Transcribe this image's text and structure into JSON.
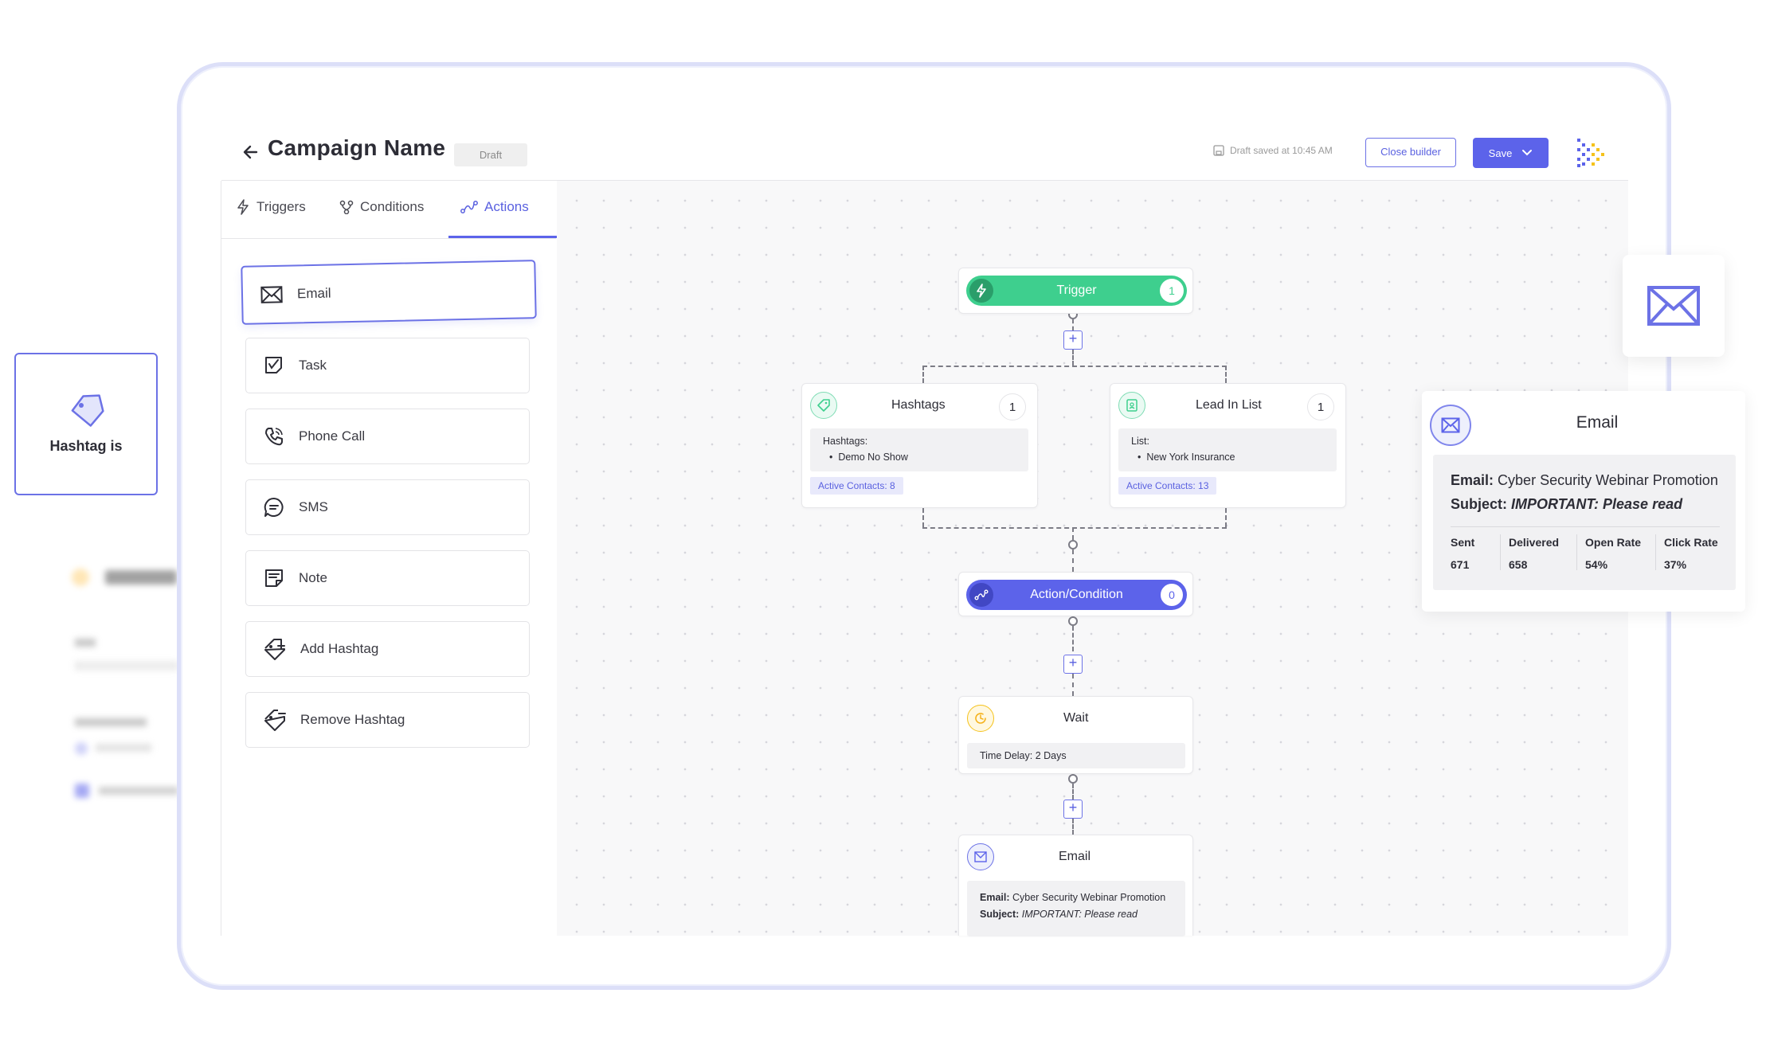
{
  "header": {
    "title": "Campaign Name",
    "status_badge": "Draft",
    "save_status": "Draft saved at 10:45 AM",
    "close_button": "Close builder",
    "save_button": "Save"
  },
  "sidebar": {
    "tabs": [
      {
        "label": "Triggers",
        "icon": "lightning-icon"
      },
      {
        "label": "Conditions",
        "icon": "branch-icon"
      },
      {
        "label": "Actions",
        "icon": "route-icon",
        "active": true
      }
    ],
    "actions": [
      {
        "label": "Email",
        "icon": "envelope-icon",
        "selected": true
      },
      {
        "label": "Task",
        "icon": "task-icon"
      },
      {
        "label": "Phone Call",
        "icon": "phone-icon"
      },
      {
        "label": "SMS",
        "icon": "chat-bubble-icon"
      },
      {
        "label": "Note",
        "icon": "note-icon"
      },
      {
        "label": "Add Hashtag",
        "icon": "tag-plus-icon"
      },
      {
        "label": "Remove Hashtag",
        "icon": "tag-minus-icon"
      }
    ]
  },
  "flow": {
    "trigger": {
      "label": "Trigger",
      "count": "1"
    },
    "hashtags": {
      "title": "Hashtags",
      "count": "1",
      "field_label": "Hashtags:",
      "value": "Demo No Show",
      "contacts": "Active Contacts: 8"
    },
    "lead_list": {
      "title": "Lead In List",
      "count": "1",
      "field_label": "List:",
      "value": "New York Insurance",
      "contacts": "Active Contacts: 13"
    },
    "action_condition": {
      "label": "Action/Condition",
      "count": "0"
    },
    "wait": {
      "title": "Wait",
      "detail_label": "Time Delay:",
      "detail_value": "2 Days"
    },
    "email": {
      "title": "Email",
      "email_label": "Email:",
      "email_value": "Cyber Security Webinar Promotion",
      "subject_label": "Subject:",
      "subject_value": "IMPORTANT: Please read"
    }
  },
  "floating": {
    "hashtag_card": "Hashtag is",
    "email_card": {
      "title": "Email",
      "email_label": "Email:",
      "email_value": "Cyber Security Webinar Promotion",
      "subject_label": "Subject:",
      "subject_value": "IMPORTANT: Please read",
      "stats": [
        {
          "label": "Sent",
          "value": "671"
        },
        {
          "label": "Delivered",
          "value": "658"
        },
        {
          "label": "Open Rate",
          "value": "54%"
        },
        {
          "label": "Click Rate",
          "value": "37%"
        }
      ]
    }
  },
  "colors": {
    "accent": "#5c63ea",
    "trigger_green": "#3ecf8e",
    "wait_yellow": "#f5c21b",
    "canvas_bg": "#f8f8f9"
  }
}
